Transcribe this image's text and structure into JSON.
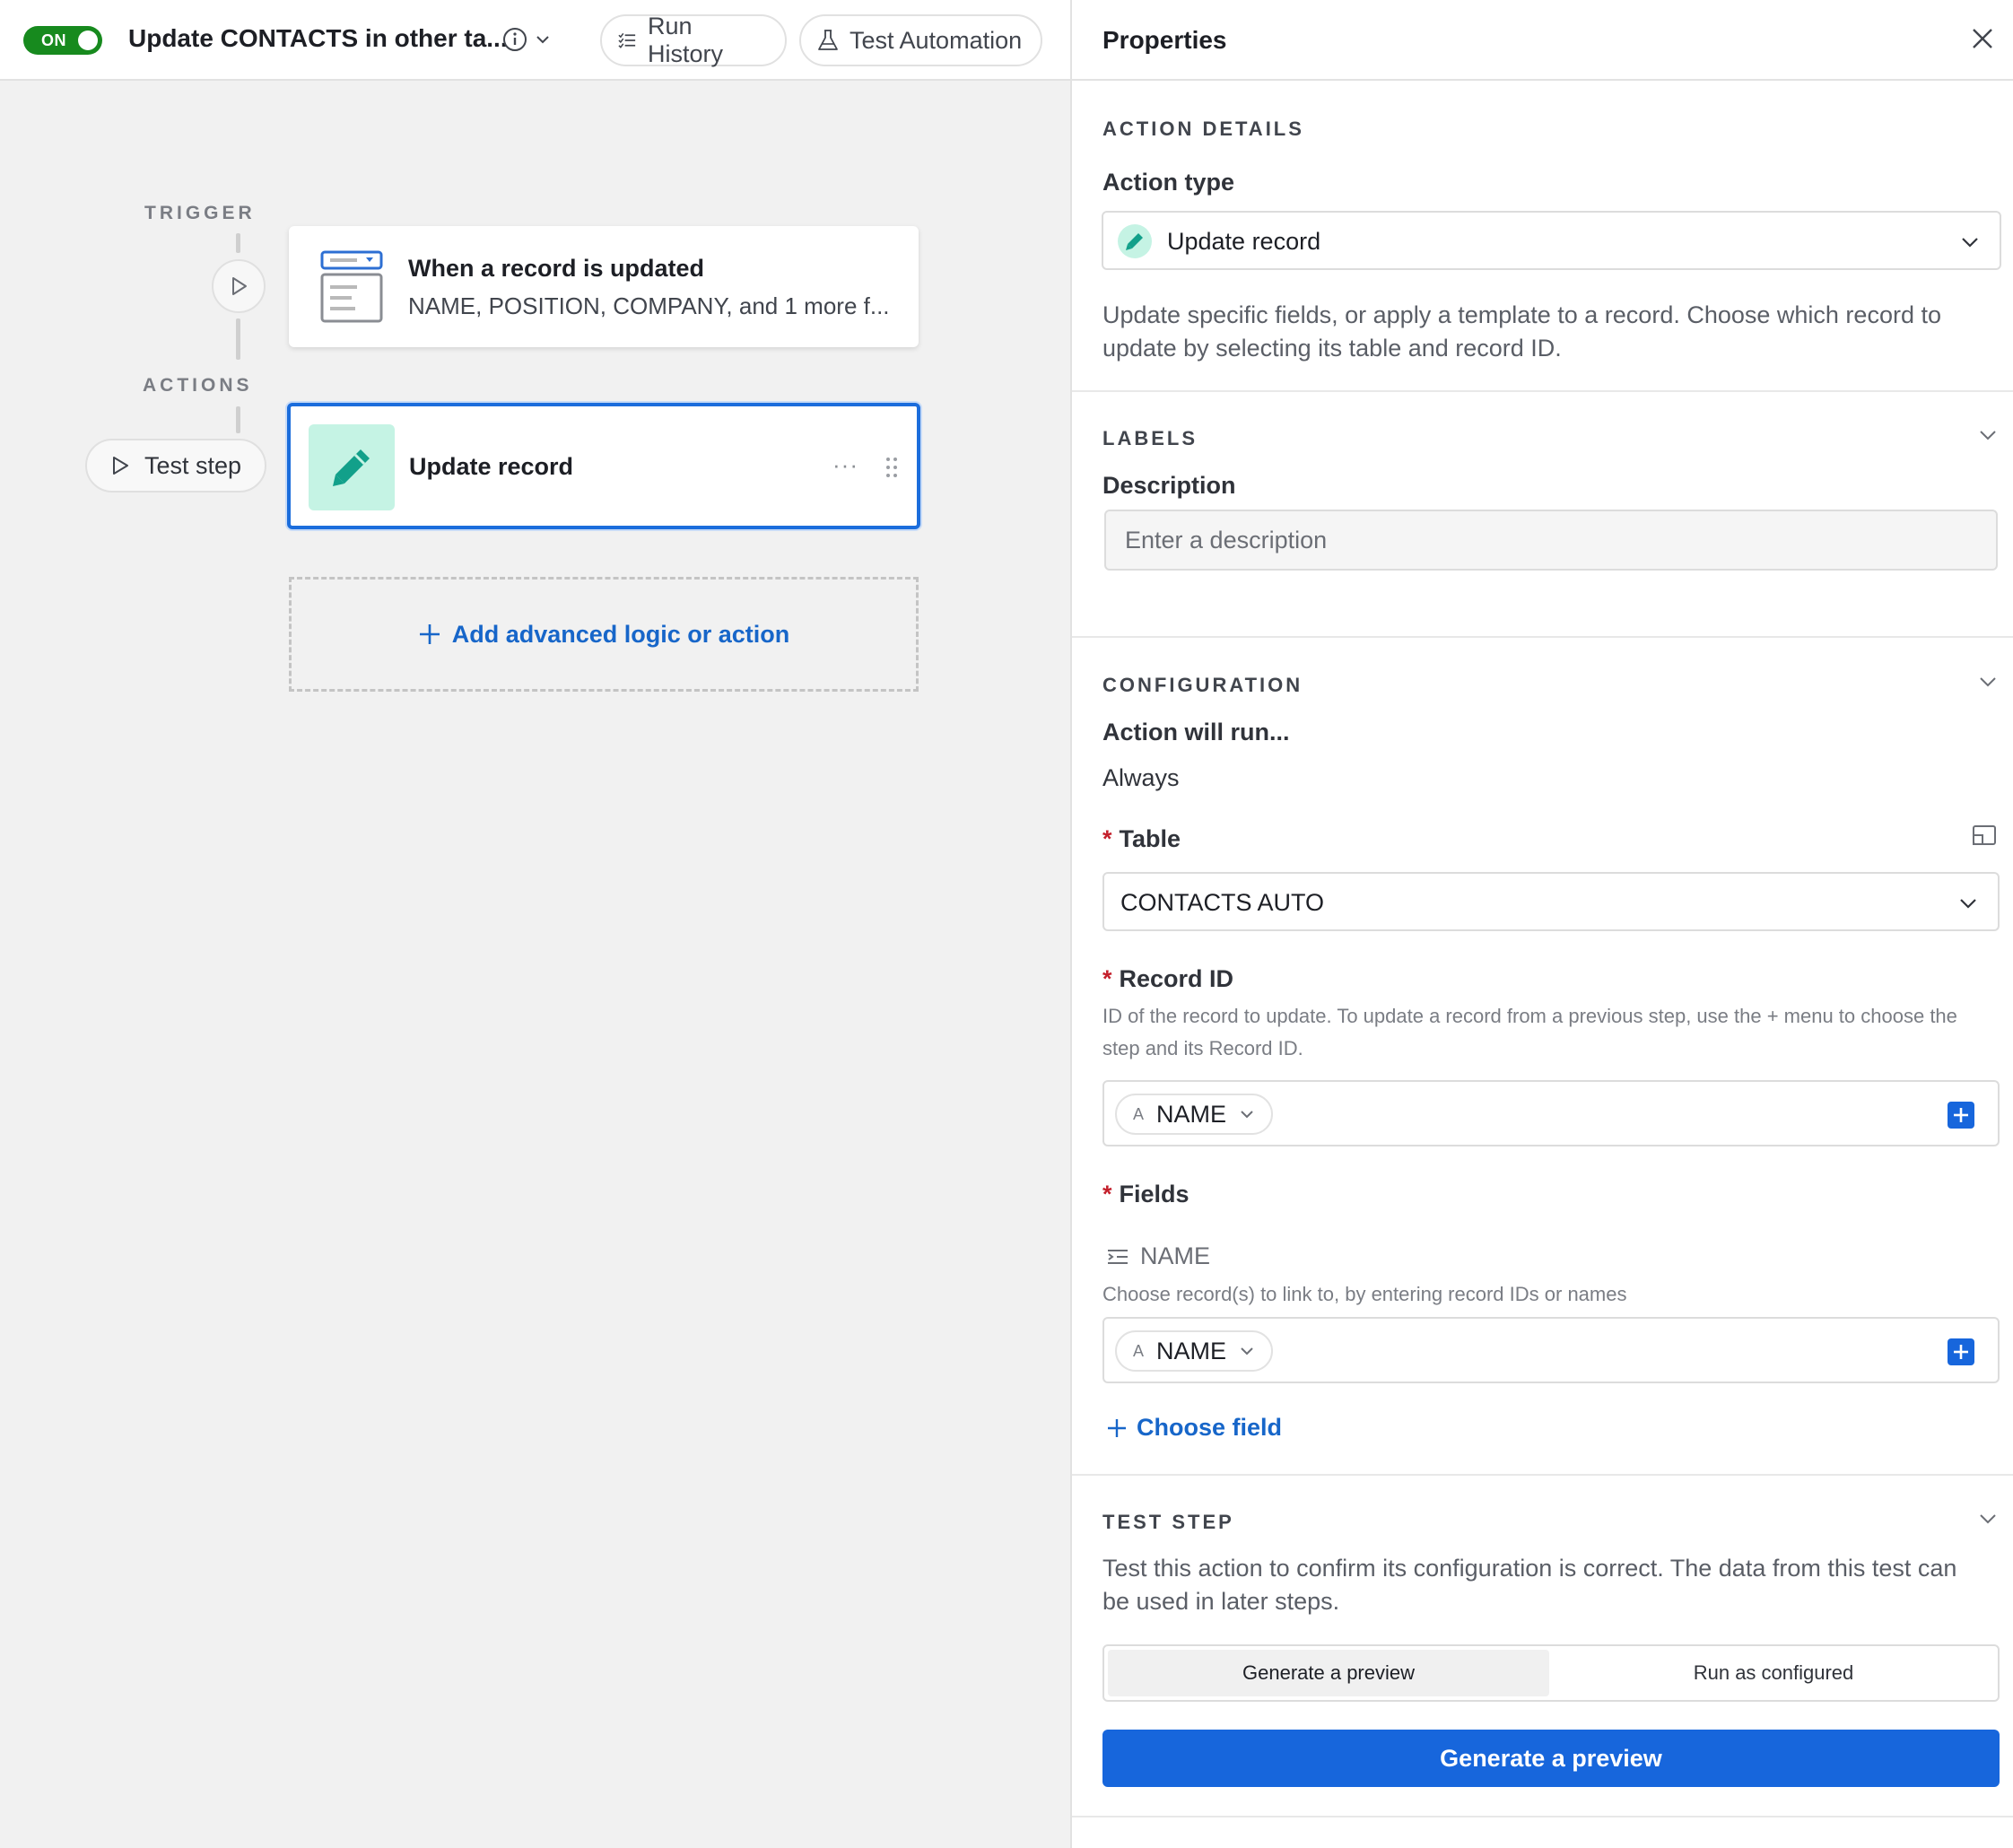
{
  "header": {
    "toggle_label": "ON",
    "automation_title": "Update CONTACTS in other ta...",
    "run_history_label": "Run History",
    "test_automation_label": "Test Automation"
  },
  "canvas": {
    "trigger_label": "TRIGGER",
    "actions_label": "ACTIONS",
    "test_step_label": "Test step",
    "trigger_card": {
      "title": "When a record is updated",
      "subtitle": "NAME, POSITION, COMPANY, and 1 more f..."
    },
    "action_card": {
      "title": "Update record",
      "more_label": "···"
    },
    "add_logic_label": "Add advanced logic or action"
  },
  "panel": {
    "title": "Properties",
    "action_details": {
      "section_title": "ACTION DETAILS",
      "action_type_label": "Action type",
      "action_type_value": "Update record",
      "description": "Update specific fields, or apply a template to a record. Choose which record to update by selecting its table and record ID."
    },
    "labels": {
      "section_title": "LABELS",
      "description_label": "Description",
      "description_placeholder": "Enter a description",
      "description_value": ""
    },
    "configuration": {
      "section_title": "CONFIGURATION",
      "run_label": "Action will run...",
      "run_value": "Always",
      "required_mark": "*",
      "table_label": "Table",
      "table_value": "CONTACTS AUTO",
      "record_id_label": "Record ID",
      "record_id_help": "ID of the record to update. To update a record from a previous step, use the + menu to choose the step and its Record ID.",
      "record_id_token": "NAME",
      "fields_label": "Fields",
      "field_name": "NAME",
      "field_help": "Choose record(s) to link to, by entering record IDs or names",
      "field_token": "NAME",
      "token_type_glyph": "A",
      "choose_field_label": "Choose field"
    },
    "test_step": {
      "section_title": "TEST STEP",
      "description": "Test this action to confirm its configuration is correct. The data from this test can be used in later steps.",
      "options": [
        "Generate a preview",
        "Run as configured"
      ],
      "selected_option": "Generate a preview",
      "button_label": "Generate a preview"
    }
  },
  "colors": {
    "accent_blue": "#1766dc",
    "toggle_green": "#178a1e",
    "action_tile": "#c5f3e4",
    "action_icon": "#12a08a",
    "required_red": "#c4202c"
  }
}
